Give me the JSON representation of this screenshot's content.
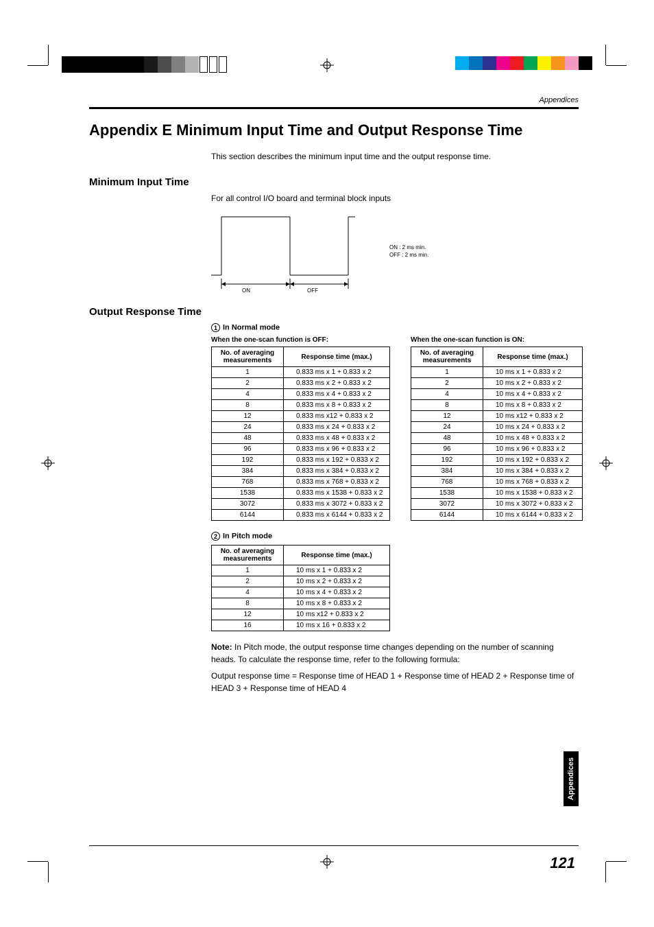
{
  "header_label": "Appendices",
  "title": "Appendix E   Minimum Input Time and Output Response Time",
  "intro": "This section describes the minimum input time and the output response time.",
  "section1": {
    "heading": "Minimum Input Time",
    "sub": "For all control I/O board and terminal block inputs",
    "diagram": {
      "on": "ON",
      "off": "OFF",
      "text_on": "ON  : 2 ms min.",
      "text_off": "OFF : 2 ms min."
    }
  },
  "section2": {
    "heading": "Output Response Time",
    "mode1_num": "1",
    "mode1": "In Normal mode",
    "sub_off": "When the one-scan function is OFF:",
    "sub_on": "When the one-scan function is ON:",
    "col1": "No. of averaging measurements",
    "col2": "Response time (max.)",
    "table_off": [
      [
        "1",
        "0.833 ms x 1 + 0.833 x 2"
      ],
      [
        "2",
        "0.833 ms x 2 + 0.833 x 2"
      ],
      [
        "4",
        "0.833 ms x 4 + 0.833 x 2"
      ],
      [
        "8",
        "0.833 ms x 8 + 0.833 x 2"
      ],
      [
        "12",
        "0.833 ms x12 + 0.833 x 2"
      ],
      [
        "24",
        "0.833 ms x 24 + 0.833 x 2"
      ],
      [
        "48",
        "0.833 ms x 48 + 0.833 x 2"
      ],
      [
        "96",
        "0.833 ms x 96 + 0.833 x 2"
      ],
      [
        "192",
        "0.833 ms x 192 + 0.833 x 2"
      ],
      [
        "384",
        "0.833 ms x 384 + 0.833 x 2"
      ],
      [
        "768",
        "0.833 ms x 768 + 0.833 x 2"
      ],
      [
        "1538",
        "0.833 ms x 1538 + 0.833 x 2"
      ],
      [
        "3072",
        "0.833 ms x 3072 + 0.833 x 2"
      ],
      [
        "6144",
        "0.833 ms x 6144 + 0.833 x 2"
      ]
    ],
    "table_on": [
      [
        "1",
        "10 ms x 1 + 0.833 x 2"
      ],
      [
        "2",
        "10 ms x 2 + 0.833 x 2"
      ],
      [
        "4",
        "10 ms x 4 + 0.833 x 2"
      ],
      [
        "8",
        "10 ms x 8 + 0.833 x 2"
      ],
      [
        "12",
        "10 ms x12 + 0.833 x 2"
      ],
      [
        "24",
        "10 ms x 24 + 0.833 x 2"
      ],
      [
        "48",
        "10 ms x 48 + 0.833 x 2"
      ],
      [
        "96",
        "10 ms x 96 + 0.833 x 2"
      ],
      [
        "192",
        "10 ms x 192 + 0.833 x 2"
      ],
      [
        "384",
        "10 ms x 384 + 0.833 x 2"
      ],
      [
        "768",
        "10 ms x 768 + 0.833 x 2"
      ],
      [
        "1538",
        "10 ms x 1538 + 0.833 x 2"
      ],
      [
        "3072",
        "10 ms x 3072 + 0.833 x 2"
      ],
      [
        "6144",
        "10 ms x 6144 + 0.833 x 2"
      ]
    ],
    "mode2_num": "2",
    "mode2": "In Pitch mode",
    "table_pitch": [
      [
        "1",
        "10 ms x 1 + 0.833 x 2"
      ],
      [
        "2",
        "10 ms x 2 + 0.833 x 2"
      ],
      [
        "4",
        "10 ms x 4 + 0.833 x 2"
      ],
      [
        "8",
        "10 ms x 8 + 0.833 x 2"
      ],
      [
        "12",
        "10 ms x12 + 0.833 x 2"
      ],
      [
        "16",
        "10 ms x 16 + 0.833 x 2"
      ]
    ]
  },
  "note_label": "Note:",
  "note_text": " In Pitch mode, the output response time changes depending on the number of scanning heads. To calculate the response time, refer to the following formula:",
  "note_formula": "Output response time = Response time of HEAD 1 + Response time of HEAD 2 + Response time of HEAD 3 + Response time of HEAD 4",
  "side_tab": "Appendices",
  "page_number": "121",
  "colors": [
    "#00aeef",
    "#0072bc",
    "#2e3192",
    "#ec008c",
    "#ed1c24",
    "#00a651",
    "#fff200",
    "#f7941d",
    "#f49ac1",
    "#000000"
  ]
}
